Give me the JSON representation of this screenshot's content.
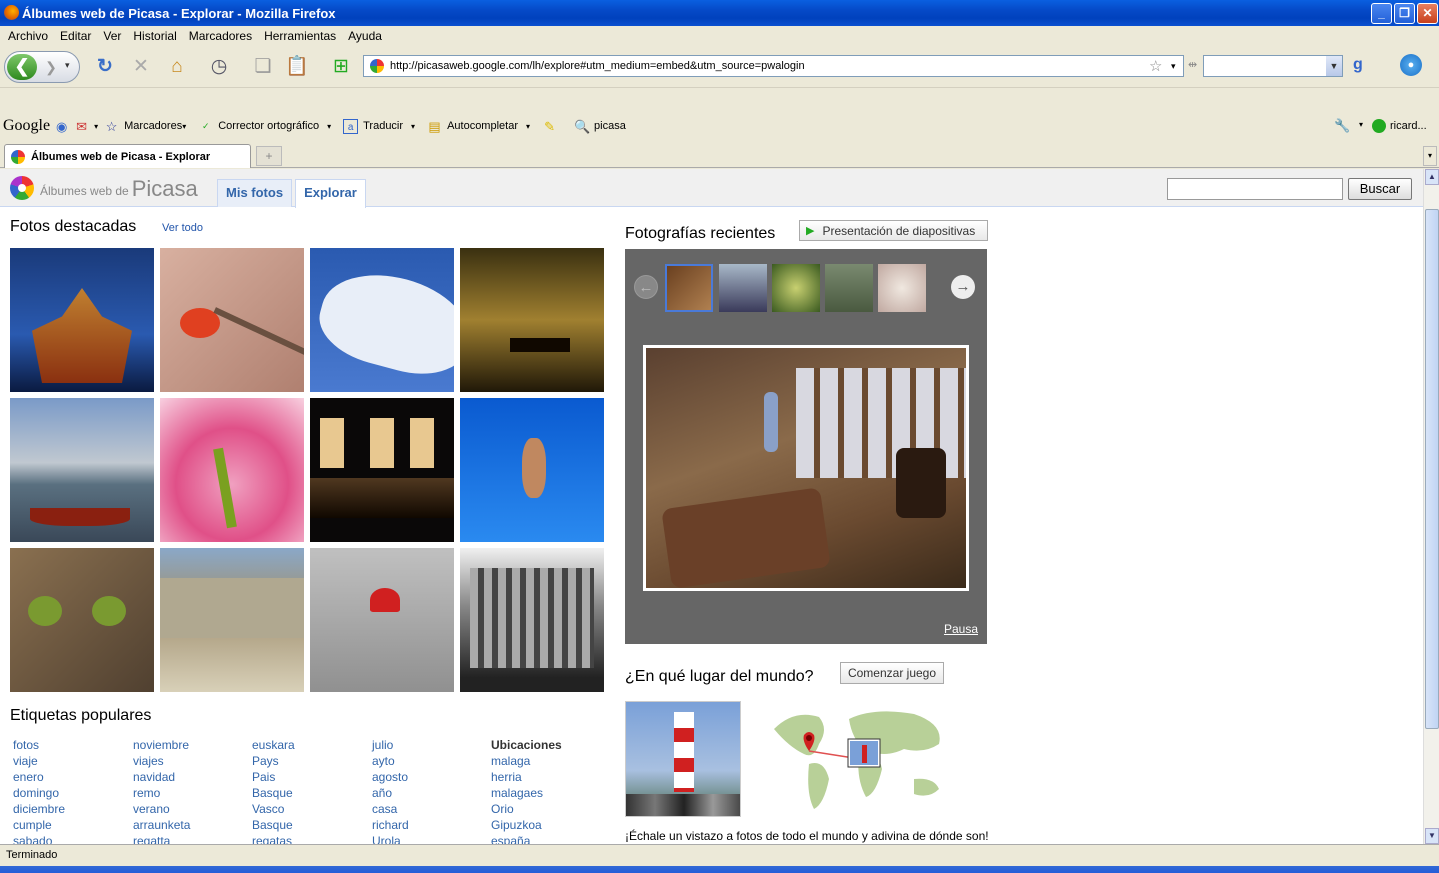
{
  "window": {
    "title": "Álbumes web de Picasa - Explorar - Mozilla Firefox"
  },
  "menu": [
    "Archivo",
    "Editar",
    "Ver",
    "Historial",
    "Marcadores",
    "Herramientas",
    "Ayuda"
  ],
  "nav": {
    "url": "http://picasaweb.google.com/lh/explore#utm_medium=embed&utm_source=pwalogin",
    "search_value": ""
  },
  "google_toolbar": {
    "logo": "Google",
    "items": [
      "Marcadores",
      "Corrector ortográfico",
      "Traducir",
      "Autocompletar",
      "picasa"
    ],
    "user": "ricard..."
  },
  "tab": {
    "title": "Álbumes web de Picasa - Explorar"
  },
  "status": "Terminado",
  "picasa": {
    "logo_prefix": "Álbumes web de",
    "logo_brand": "Picasa",
    "tabs": [
      "Mis fotos",
      "Explorar"
    ],
    "search_value": "",
    "search_button": "Buscar"
  },
  "featured": {
    "title": "Fotos destacadas",
    "see_all": "Ver todo"
  },
  "tags": {
    "title": "Etiquetas populares",
    "columns": [
      [
        "fotos",
        "viaje",
        "enero",
        "domingo",
        "diciembre",
        "cumple",
        "sabado"
      ],
      [
        "noviembre",
        "viajes",
        "navidad",
        "remo",
        "verano",
        "arraunketa",
        "regatta"
      ],
      [
        "euskara",
        "Pays",
        "Pais",
        "Basque",
        "Vasco",
        "Basque",
        "regatas"
      ],
      [
        "julio",
        "ayto",
        "agosto",
        "año",
        "casa",
        "richard",
        "Urola"
      ]
    ],
    "locations_title": "Ubicaciones",
    "locations": [
      "malaga",
      "herria",
      "malagaes",
      "Orio",
      "Gipuzkoa",
      "españa"
    ]
  },
  "recent": {
    "title": "Fotografías recientes",
    "slideshow_button": "Presentación de diapositivas",
    "pause": "Pausa"
  },
  "geo": {
    "title": "¿En qué lugar del mundo?",
    "button": "Comenzar juego",
    "description": "¡Échale un vistazo a fotos de todo el mundo y adivina de dónde son!"
  }
}
